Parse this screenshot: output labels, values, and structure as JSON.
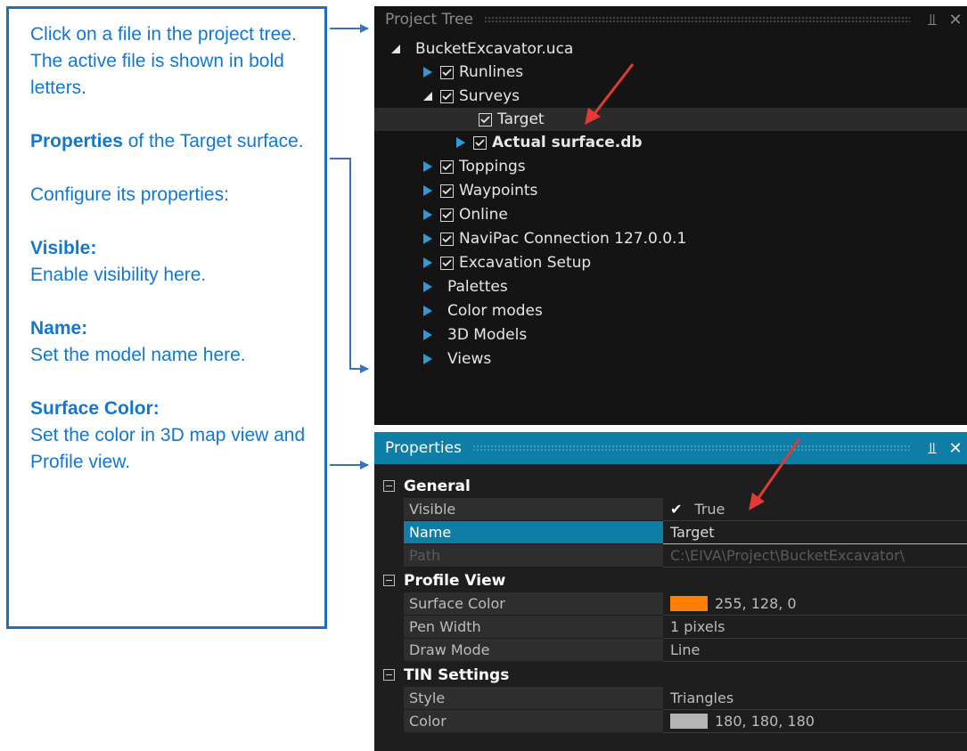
{
  "callout": {
    "intro": "Click on a file in the project tree. The active file is shown in bold letters.",
    "properties_bold": "Properties",
    "properties_rest": " of the Target surface.",
    "configure": "Configure its properties:",
    "visible_title": "Visible:",
    "visible_text": "Enable visibility here.",
    "name_title": "Name:",
    "name_text": "Set the model name here.",
    "surface_title": "Surface Color:",
    "surface_text": "Set the color in 3D map view and Profile view."
  },
  "tree": {
    "title": "Project Tree",
    "pin_icon": "pin-icon",
    "close_icon": "close-icon",
    "root": "BucketExcavator.uca",
    "runlines": "Runlines",
    "surveys": "Surveys",
    "target": "Target",
    "actual_surface": "Actual surface.db",
    "toppings": "Toppings",
    "waypoints": "Waypoints",
    "online": "Online",
    "navipac": "NaviPac Connection 127.0.0.1",
    "excavation": "Excavation Setup",
    "palettes": "Palettes",
    "color_modes": "Color modes",
    "models_3d": "3D Models",
    "views": "Views"
  },
  "properties": {
    "title": "Properties",
    "general": {
      "label": "General",
      "visible_name": "Visible",
      "visible_value": "True",
      "name_name": "Name",
      "name_value": "Target",
      "path_name": "Path",
      "path_value": "C:\\EIVA\\Project\\BucketExcavator\\"
    },
    "profile_view": {
      "label": "Profile View",
      "surface_color_name": "Surface Color",
      "surface_color_value": "255, 128, 0",
      "surface_color_hex": "#ff8000",
      "pen_width_name": "Pen Width",
      "pen_width_value": "1 pixels",
      "draw_mode_name": "Draw Mode",
      "draw_mode_value": "Line"
    },
    "tin_settings": {
      "label": "TIN Settings",
      "style_name": "Style",
      "style_value": "Triangles",
      "color_name": "Color",
      "color_value": "180, 180, 180",
      "color_hex": "#b4b4b4"
    }
  },
  "colors": {
    "callout_text": "#1477cf",
    "callout_border": "#1f6fbd",
    "header_blue": "#0f7ea6",
    "annotation_arrow": "#e53935"
  }
}
